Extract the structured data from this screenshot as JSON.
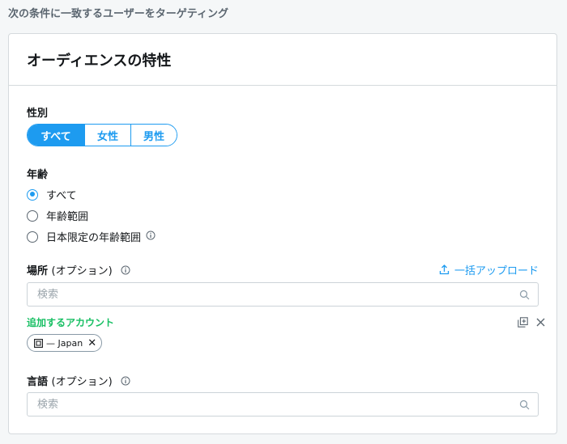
{
  "page": {
    "heading": "次の条件に一致するユーザーをターゲティング"
  },
  "card": {
    "title": "オーディエンスの特性"
  },
  "gender": {
    "label": "性別",
    "options": [
      {
        "label": "すべて",
        "active": true
      },
      {
        "label": "女性",
        "active": false
      },
      {
        "label": "男性",
        "active": false
      }
    ]
  },
  "age": {
    "label": "年齢",
    "options": [
      {
        "label": "すべて",
        "checked": true
      },
      {
        "label": "年齢範囲",
        "checked": false
      },
      {
        "label": "日本限定の年齢範囲",
        "checked": false
      }
    ]
  },
  "location": {
    "label": "場所",
    "optional": "(オプション)",
    "bulk_upload": "一括アップロード",
    "search_placeholder": "検索",
    "added_label": "追加するアカウント",
    "chips": [
      {
        "label": "— Japan"
      }
    ]
  },
  "language": {
    "label": "言語",
    "optional": "(オプション)",
    "search_placeholder": "検索"
  },
  "colors": {
    "accent": "#1d9bf0",
    "success": "#17bf63",
    "border": "#ccd3d8"
  }
}
